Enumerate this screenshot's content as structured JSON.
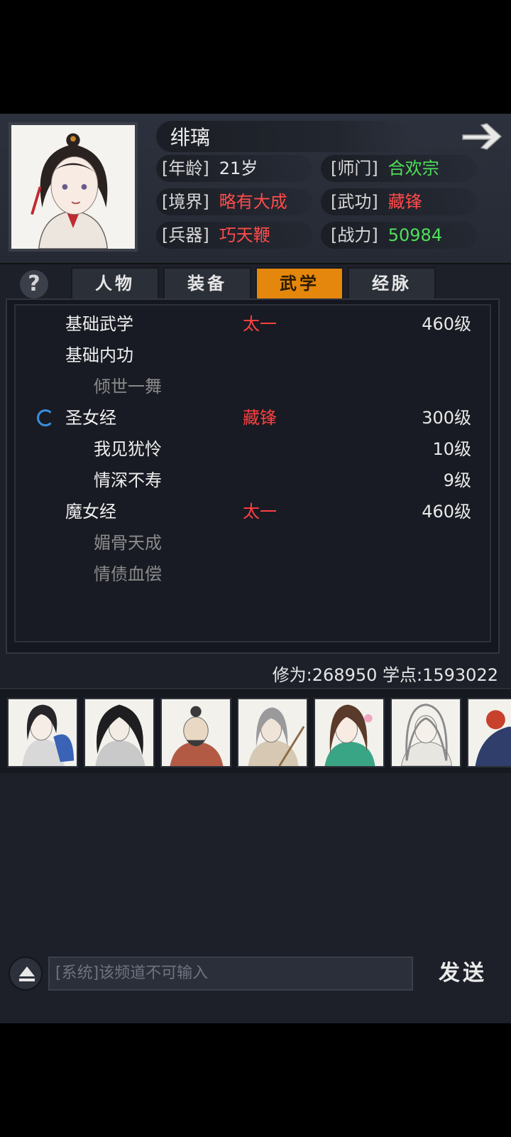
{
  "character": {
    "name": "绯璃",
    "stats": [
      {
        "label": "[年龄]",
        "value": "21岁",
        "color": "#e6e6e6"
      },
      {
        "label": "[师门]",
        "value": "合欢宗",
        "color": "#4ee05a"
      },
      {
        "label": "[境界]",
        "value": "略有大成",
        "color": "#ff4b4b"
      },
      {
        "label": "[武功]",
        "value": "藏锋",
        "color": "#ff4b4b"
      },
      {
        "label": "[兵器]",
        "value": "巧天鞭",
        "color": "#ff4b4b"
      },
      {
        "label": "[战力]",
        "value": "50984",
        "color": "#4ee05a"
      }
    ]
  },
  "tabs": [
    {
      "label": "人物",
      "active": false
    },
    {
      "label": "装备",
      "active": false
    },
    {
      "label": "武学",
      "active": true
    },
    {
      "label": "经脉",
      "active": false
    }
  ],
  "help_label": "?",
  "skills": [
    {
      "name": "基础武学",
      "tag": "太一",
      "level": "460级",
      "sub": false,
      "dim": false,
      "spinner": false
    },
    {
      "name": "基础内功",
      "tag": "",
      "level": "",
      "sub": false,
      "dim": false,
      "spinner": false
    },
    {
      "name": "倾世一舞",
      "tag": "",
      "level": "",
      "sub": true,
      "dim": true,
      "spinner": false
    },
    {
      "name": "圣女经",
      "tag": "藏锋",
      "level": "300级",
      "sub": false,
      "dim": false,
      "spinner": true
    },
    {
      "name": "我见犹怜",
      "tag": "",
      "level": "10级",
      "sub": true,
      "dim": false,
      "spinner": false
    },
    {
      "name": "情深不寿",
      "tag": "",
      "level": "9级",
      "sub": true,
      "dim": false,
      "spinner": false
    },
    {
      "name": "魔女经",
      "tag": "太一",
      "level": "460级",
      "sub": false,
      "dim": false,
      "spinner": false
    },
    {
      "name": "媚骨天成",
      "tag": "",
      "level": "",
      "sub": true,
      "dim": true,
      "spinner": false
    },
    {
      "name": "情债血偿",
      "tag": "",
      "level": "",
      "sub": true,
      "dim": true,
      "spinner": false
    }
  ],
  "progress": {
    "text": "修为:268950  学点:1593022"
  },
  "companion_count": 7,
  "chat": {
    "placeholder": "[系统]该频道不可输入",
    "send_label": "发送"
  }
}
